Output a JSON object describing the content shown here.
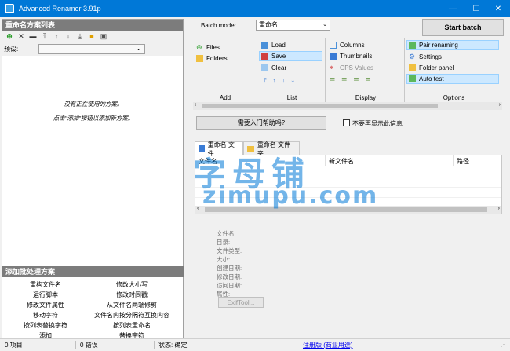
{
  "window": {
    "title": "Advanced Renamer 3.91p",
    "minimize": "—",
    "maximize": "☐",
    "close": "✕"
  },
  "left_panel": {
    "header": "重命名方案列表",
    "preset_label": "预设:",
    "empty_line1": "没有正在使用的方案。",
    "empty_line2": "点击\"添加\"按钮以添加新方案。",
    "batch_header": "添加批处理方案",
    "methods": [
      [
        "重构文件名",
        "修改大小写"
      ],
      [
        "运行脚本",
        "修改时间戳"
      ],
      [
        "修改文件属性",
        "从文件名两端修剪"
      ],
      [
        "移动字符",
        "文件名内按分隔符互换内容"
      ],
      [
        "按列表替换字符",
        "按列表重命名"
      ],
      [
        "添加",
        "替换字符"
      ]
    ]
  },
  "top": {
    "batch_mode_label": "Batch mode:",
    "batch_mode_value": "重命名",
    "start_batch": "Start batch"
  },
  "groups": {
    "add": {
      "label": "Add",
      "items": [
        "Files",
        "Folders"
      ]
    },
    "list": {
      "label": "List",
      "items": [
        "Load",
        "Save",
        "Clear"
      ]
    },
    "display": {
      "label": "Display",
      "items": [
        "Columns",
        "Thumbnails",
        "GPS Values"
      ]
    },
    "options": {
      "label": "Options",
      "items": [
        "Pair renaming",
        "Settings",
        "Folder panel",
        "Auto test"
      ]
    }
  },
  "help": {
    "button": "需要入门帮助吗?",
    "dont_show": "不要再显示此信息"
  },
  "tabs": [
    "重命名 文件",
    "重命名 文件夹"
  ],
  "grid": {
    "columns": [
      "文件名",
      "新文件名",
      "路径"
    ]
  },
  "properties": [
    "文件名:",
    "目录:",
    "文件类型:",
    "大小:",
    "创建日期:",
    "修改日期:",
    "访问日期:",
    "属性:"
  ],
  "exif_button": "ExifTool...",
  "status": {
    "items": "0 项目",
    "errors": "0 错误",
    "state": "状态: 确定",
    "register": "注册版 (商业用途)"
  },
  "watermark": {
    "line1": "字母铺",
    "line2": "zimupu.com"
  },
  "colors": {
    "titlebar": "#0078d7",
    "highlight": "#cce8ff",
    "panel_header": "#7c7c7c"
  }
}
